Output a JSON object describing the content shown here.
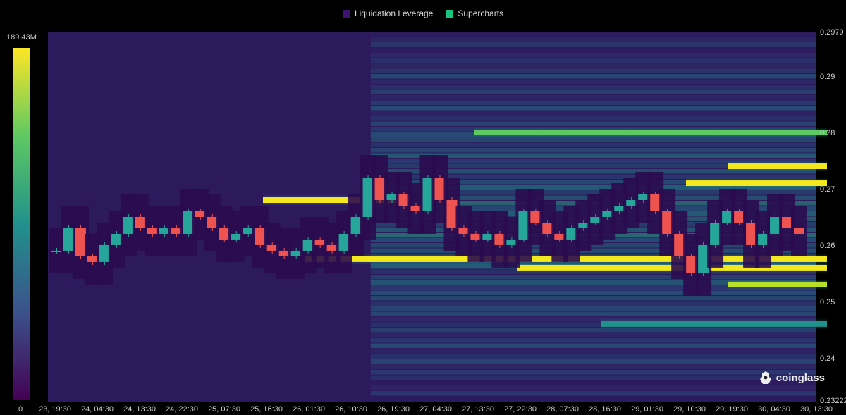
{
  "legend": {
    "items": [
      {
        "label": "Liquidation Leverage",
        "color": "#3d1470"
      },
      {
        "label": "Supercharts",
        "color": "#18c47d"
      }
    ]
  },
  "colorbar": {
    "max_label": "189.43M",
    "min_label": "0",
    "colors": [
      "#440154",
      "#3b528b",
      "#21918c",
      "#5ec962",
      "#fde725"
    ]
  },
  "brand": {
    "name": "coinglass",
    "icon": "coinglass-logo-icon"
  },
  "chart_data": {
    "type": "heatmap",
    "title": "",
    "ylim": [
      0.23222,
      0.2979
    ],
    "y_ticks": [
      "0.2979",
      "0.29",
      "0.28",
      "0.27",
      "0.26",
      "0.25",
      "0.24",
      "0.23222"
    ],
    "x_ticks": [
      "23, 19:30",
      "24, 04:30",
      "24, 13:30",
      "24, 22:30",
      "25, 07:30",
      "25, 16:30",
      "26, 01:30",
      "26, 10:30",
      "26, 19:30",
      "27, 04:30",
      "27, 13:30",
      "27, 22:30",
      "28, 07:30",
      "28, 16:30",
      "29, 01:30",
      "29, 10:30",
      "29, 19:30",
      "30, 04:30",
      "30, 13:30"
    ],
    "price_series": {
      "name": "",
      "up_color": "#26a69a",
      "down_color": "#ef5350",
      "values": [
        0.259,
        0.263,
        0.258,
        0.257,
        0.26,
        0.262,
        0.265,
        0.263,
        0.262,
        0.263,
        0.262,
        0.266,
        0.265,
        0.263,
        0.261,
        0.262,
        0.263,
        0.26,
        0.259,
        0.258,
        0.259,
        0.261,
        0.26,
        0.259,
        0.262,
        0.265,
        0.272,
        0.268,
        0.269,
        0.267,
        0.266,
        0.272,
        0.268,
        0.263,
        0.262,
        0.261,
        0.262,
        0.26,
        0.261,
        0.266,
        0.264,
        0.262,
        0.261,
        0.263,
        0.264,
        0.265,
        0.266,
        0.267,
        0.268,
        0.269,
        0.266,
        0.262,
        0.258,
        0.255,
        0.26,
        0.264,
        0.266,
        0.264,
        0.26,
        0.262,
        0.265,
        0.263,
        0.262
      ]
    },
    "liquidation_bands": [
      {
        "price": 0.2575,
        "start": "26, 01:30",
        "end": "30, 13:30",
        "intensity": 1.0
      },
      {
        "price": 0.256,
        "start": "27, 22:30",
        "end": "30, 13:30",
        "intensity": 1.0
      },
      {
        "price": 0.274,
        "start": "29, 19:30",
        "end": "30, 13:30",
        "intensity": 1.0
      },
      {
        "price": 0.271,
        "start": "29, 10:30",
        "end": "30, 13:30",
        "intensity": 0.95
      },
      {
        "price": 0.268,
        "start": "25, 16:30",
        "end": "26, 19:30",
        "intensity": 0.9
      },
      {
        "price": 0.28,
        "start": "27, 13:30",
        "end": "30, 13:30",
        "intensity": 0.6
      },
      {
        "price": 0.246,
        "start": "28, 16:30",
        "end": "30, 13:30",
        "intensity": 0.5
      },
      {
        "price": 0.253,
        "start": "29, 19:30",
        "end": "30, 13:30",
        "intensity": 0.8
      }
    ]
  }
}
